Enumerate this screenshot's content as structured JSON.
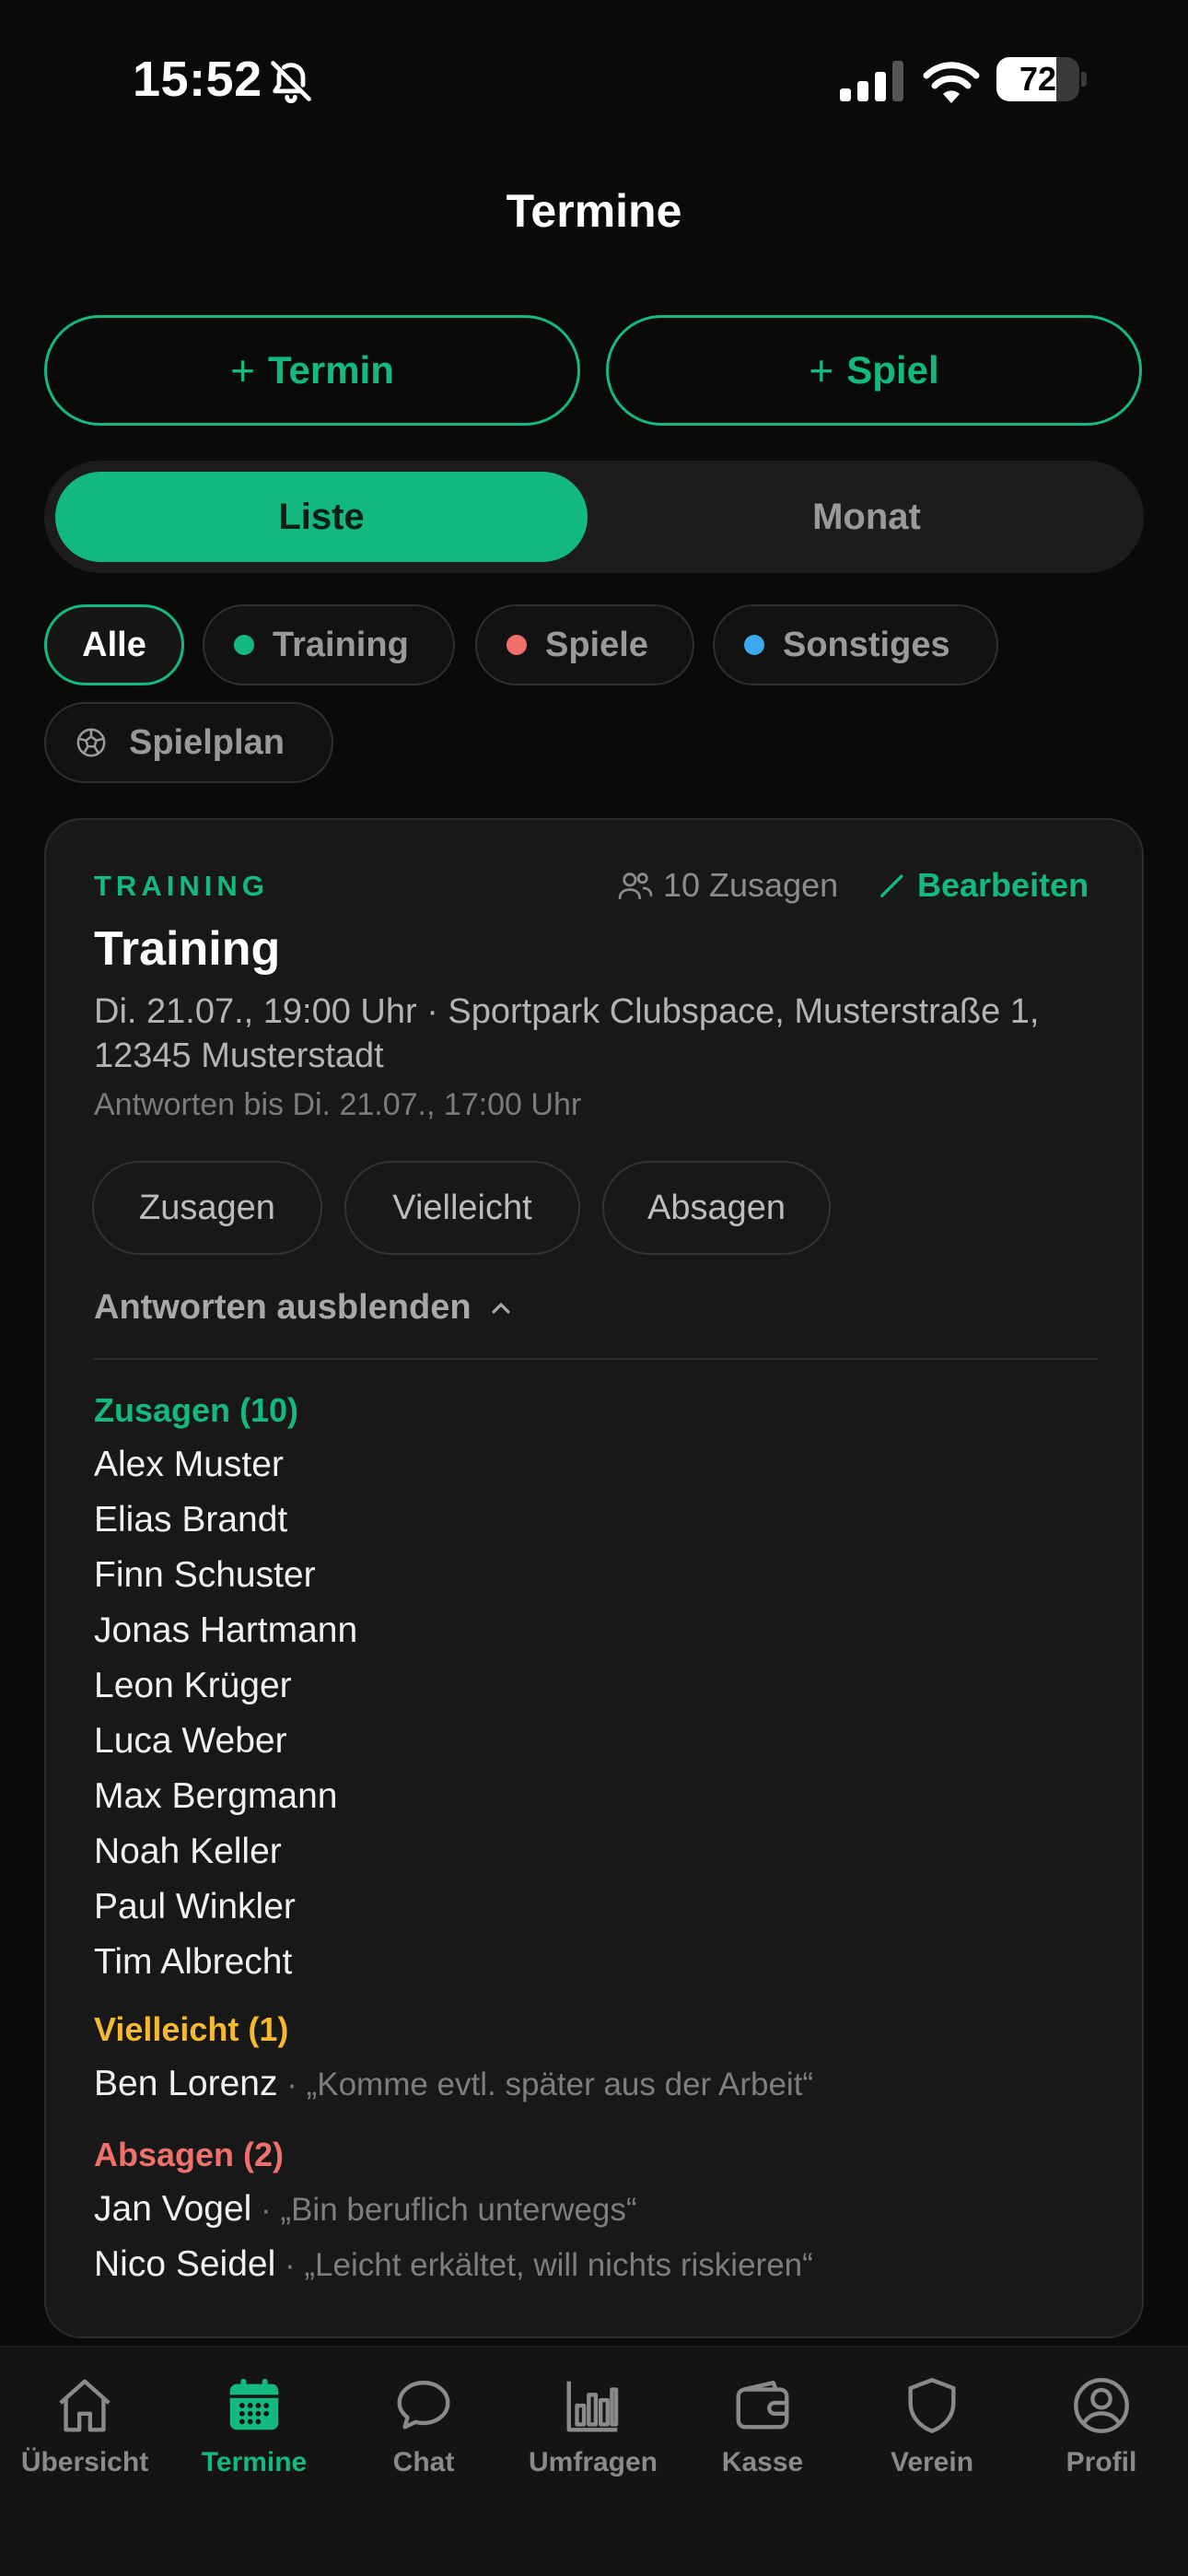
{
  "status_bar": {
    "time": "15:52",
    "battery": "72",
    "battery_level": 0.72
  },
  "header": {
    "title": "Termine"
  },
  "actions": [
    {
      "plus": "+",
      "label": "Termin"
    },
    {
      "plus": "+",
      "label": "Spiel"
    }
  ],
  "view_toggle": {
    "list": "Liste",
    "month": "Monat",
    "selected": "Liste"
  },
  "filters": {
    "all": "Alle",
    "training": "Training",
    "games": "Spiele",
    "other": "Sonstiges",
    "schedule": "Spielplan",
    "selected": "Alle"
  },
  "colors": {
    "accent": "#13b981",
    "training_dot": "#13b981",
    "games_dot": "#f0706b",
    "other_dot": "#3aa9f0",
    "maybe": "#f5b82e",
    "declined": "#f0706b"
  },
  "event": {
    "type": "TRAINING",
    "accept_count": "10 Zusagen",
    "edit": "Bearbeiten",
    "title": "Training",
    "meta": "Di. 21.07., 19:00 Uhr · Sportpark Clubspace, Musterstraße 1, 12345 Musterstadt",
    "deadline": "Antworten bis Di. 21.07., 17:00 Uhr",
    "rsvp": {
      "accept": "Zusagen",
      "maybe": "Vielleicht",
      "decline": "Absagen"
    },
    "toggle_answers": "Antworten ausblenden",
    "accepted": {
      "heading": "Zusagen (10)",
      "names": [
        "Alex Muster",
        "Elias Brandt",
        "Finn Schuster",
        "Jonas Hartmann",
        "Leon Krüger",
        "Luca Weber",
        "Max Bergmann",
        "Noah Keller",
        "Paul Winkler",
        "Tim Albrecht"
      ]
    },
    "maybe": {
      "heading": "Vielleicht (1)",
      "entries": [
        {
          "name": "Ben Lorenz",
          "comment": " · „Komme evtl. später aus der Arbeit“"
        }
      ]
    },
    "declined": {
      "heading": "Absagen (2)",
      "entries": [
        {
          "name": "Jan Vogel",
          "comment": " · „Bin beruflich unterwegs“"
        },
        {
          "name": "Nico Seidel",
          "comment": " · „Leicht erkältet, will nichts riskieren“"
        }
      ]
    }
  },
  "tab_bar": {
    "items": [
      {
        "label": "Übersicht",
        "icon": "home-icon"
      },
      {
        "label": "Termine",
        "icon": "calendar-icon"
      },
      {
        "label": "Chat",
        "icon": "chat-icon"
      },
      {
        "label": "Umfragen",
        "icon": "bar-chart-icon"
      },
      {
        "label": "Kasse",
        "icon": "wallet-icon"
      },
      {
        "label": "Verein",
        "icon": "shield-icon"
      },
      {
        "label": "Profil",
        "icon": "profile-icon"
      }
    ],
    "active": "Termine"
  }
}
